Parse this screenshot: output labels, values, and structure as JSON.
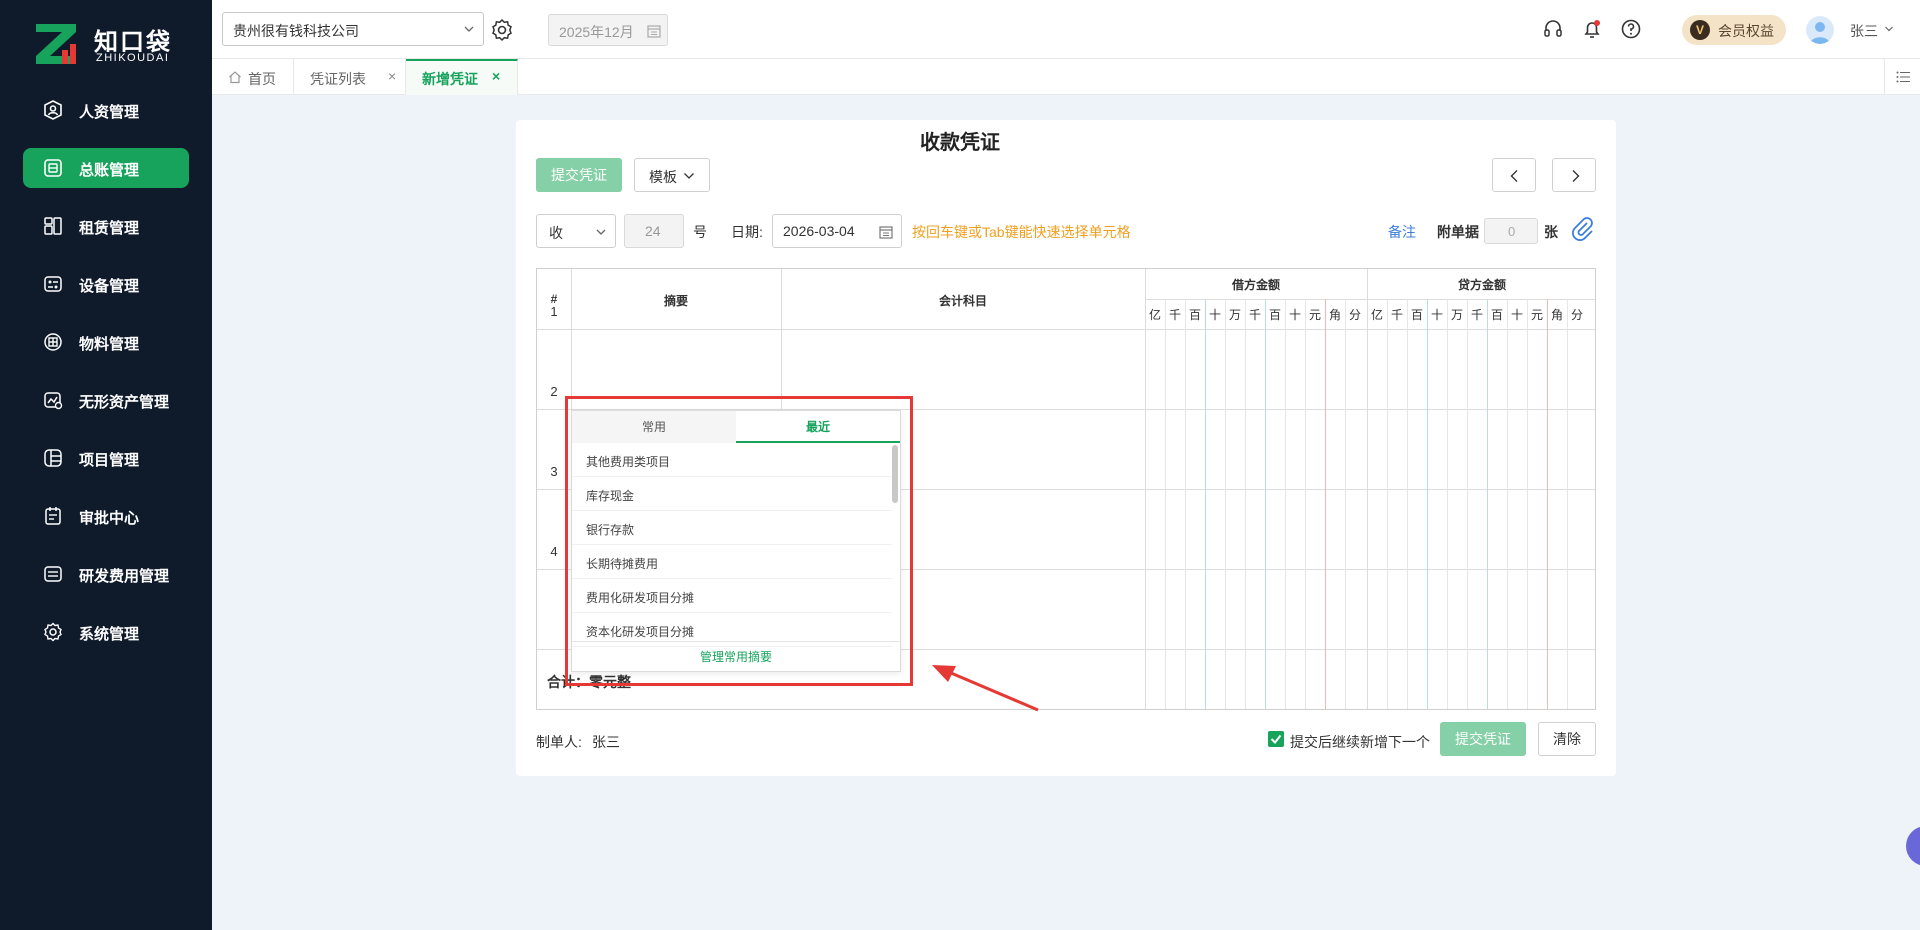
{
  "brand": {
    "name": "知口袋",
    "sub": "ZHIKOUDAI",
    "accent": "#17a35c"
  },
  "sidebar": {
    "items": [
      {
        "label": "人资管理",
        "icon": "person-badge-icon"
      },
      {
        "label": "总账管理",
        "icon": "ledger-icon",
        "active": true
      },
      {
        "label": "租赁管理",
        "icon": "lease-icon"
      },
      {
        "label": "设备管理",
        "icon": "device-icon"
      },
      {
        "label": "物料管理",
        "icon": "material-icon"
      },
      {
        "label": "无形资产管理",
        "icon": "intangible-asset-icon"
      },
      {
        "label": "项目管理",
        "icon": "project-icon"
      },
      {
        "label": "审批中心",
        "icon": "approval-icon"
      },
      {
        "label": "研发费用管理",
        "icon": "rd-expense-icon"
      },
      {
        "label": "系统管理",
        "icon": "gear-icon"
      }
    ]
  },
  "header": {
    "company": "贵州很有钱科技公司",
    "period": "2025年12月",
    "vip_label": "会员权益",
    "vip_badge": "V",
    "user_name": "张三"
  },
  "tabs": [
    {
      "label": "首页",
      "icon": "home-icon"
    },
    {
      "label": "凭证列表",
      "close": "×"
    },
    {
      "label": "新增凭证",
      "close": "×",
      "active": true
    }
  ],
  "voucher": {
    "title": "收款凭证",
    "submit_label": "提交凭证",
    "template_label": "模板",
    "type": "收",
    "number": "24",
    "number_suffix": "号",
    "date_label": "日期:",
    "date": "2026-03-04",
    "hint": "按回车键或Tab键能快速选择单元格",
    "remark_label": "备注",
    "attach_label": "附单据",
    "attach_count": "0",
    "attach_unit": "张",
    "table": {
      "col_index": "#",
      "col_summary": "摘要",
      "col_account": "会计科目",
      "col_debit": "借方金额",
      "col_credit": "贷方金额",
      "digits": [
        "亿",
        "千",
        "百",
        "十",
        "万",
        "千",
        "百",
        "十",
        "元",
        "角",
        "分"
      ],
      "rows": [
        "1",
        "2",
        "3",
        "4"
      ],
      "total": "合计：零元整"
    },
    "maker_label": "制单人:",
    "maker": "张三",
    "continue_label": "提交后继续新增下一个",
    "clear_label": "清除"
  },
  "popup": {
    "tabs": [
      "常用",
      "最近"
    ],
    "options": [
      "其他费用类项目",
      "库存现金",
      "银行存款",
      "长期待摊费用",
      "费用化研发项目分摊",
      "资本化研发项目分摊"
    ],
    "footer": "管理常用摘要"
  }
}
